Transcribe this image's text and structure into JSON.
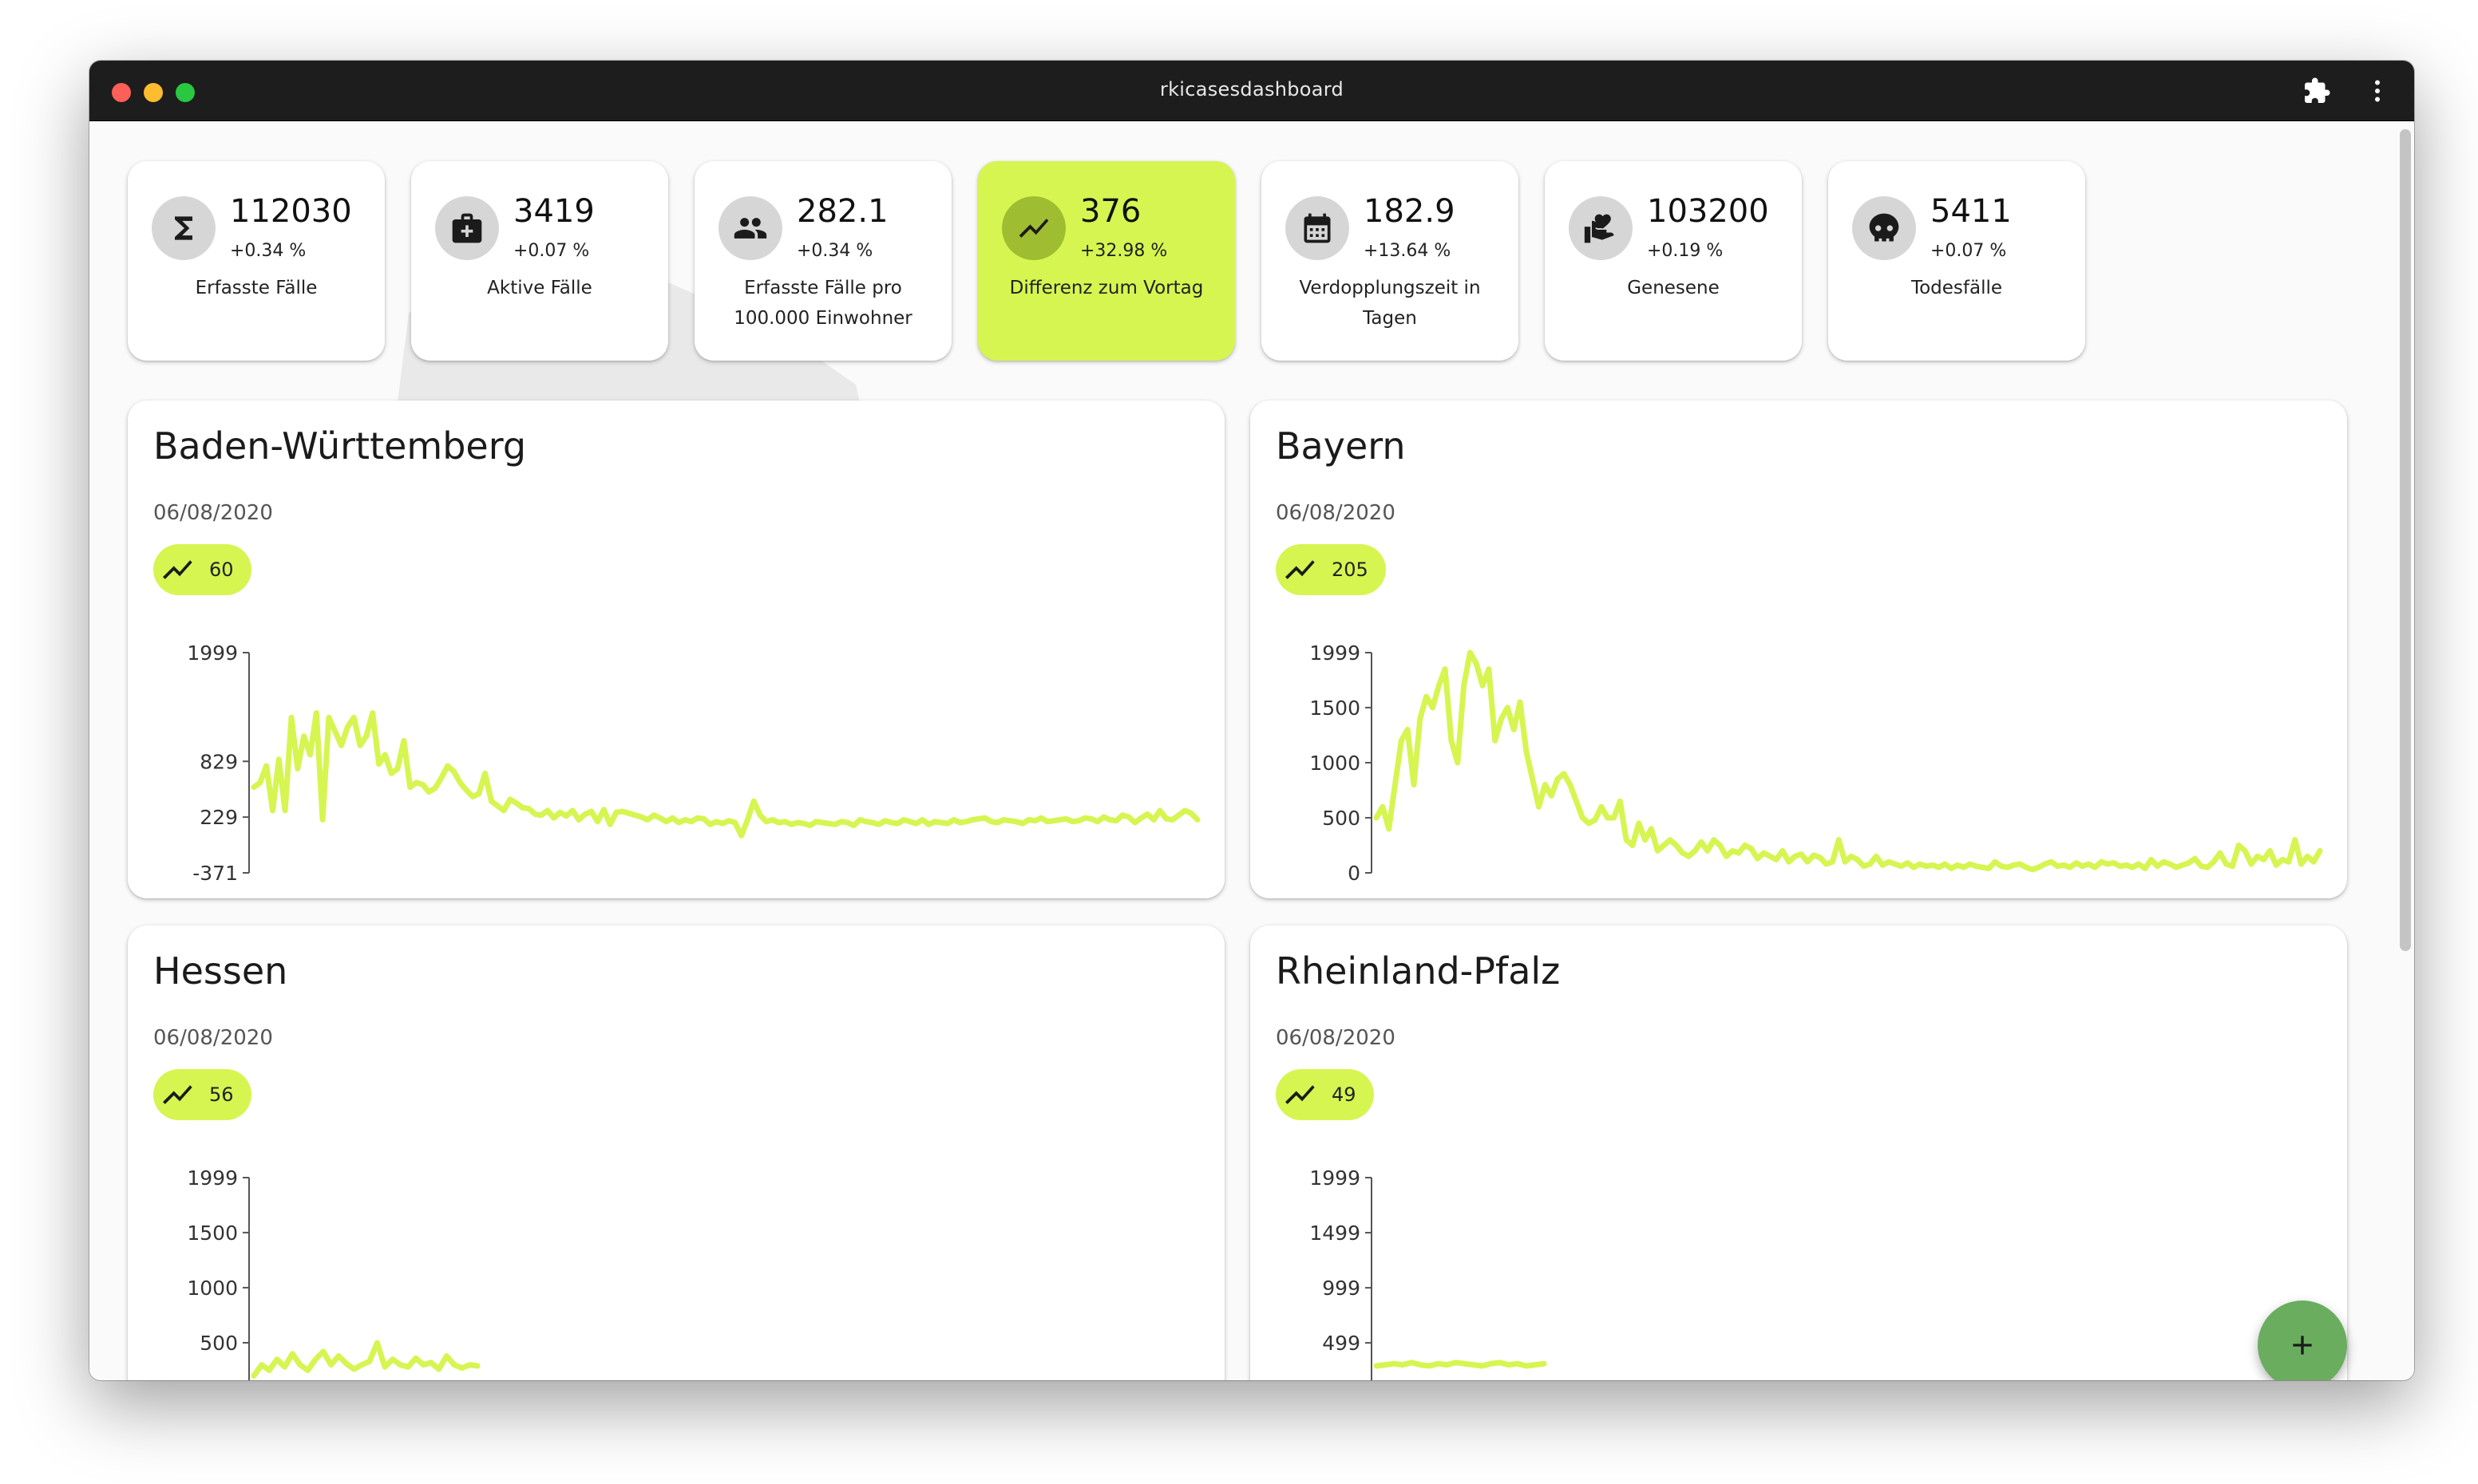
{
  "window": {
    "title": "rkicasesdashboard"
  },
  "colors": {
    "accent": "#d6f551",
    "line": "#d6f551",
    "fab": "#6aad5f",
    "titlebar": "#1d1d1d"
  },
  "stats": [
    {
      "icon": "sigma-icon",
      "value": "112030",
      "change": "+0.34 %",
      "label": "Erfasste Fälle",
      "active": false
    },
    {
      "icon": "medical-bag-icon",
      "value": "3419",
      "change": "+0.07 %",
      "label": "Aktive Fälle",
      "active": false
    },
    {
      "icon": "people-icon",
      "value": "282.1",
      "change": "+0.34 %",
      "label": "Erfasste Fälle pro 100.000 Einwohner",
      "active": false
    },
    {
      "icon": "trending-icon",
      "value": "376",
      "change": "+32.98 %",
      "label": "Differenz zum Vortag",
      "active": true
    },
    {
      "icon": "calendar-icon",
      "value": "182.9",
      "change": "+13.64 %",
      "label": "Verdopplungszeit in Tagen",
      "active": false
    },
    {
      "icon": "heart-hand-icon",
      "value": "103200",
      "change": "+0.19 %",
      "label": "Genesene",
      "active": false
    },
    {
      "icon": "skull-icon",
      "value": "5411",
      "change": "+0.07 %",
      "label": "Todesfälle",
      "active": false
    }
  ],
  "cards": [
    {
      "title": "Baden-Württemberg",
      "date": "06/08/2020",
      "chip_value": "60"
    },
    {
      "title": "Bayern",
      "date": "06/08/2020",
      "chip_value": "205"
    },
    {
      "title": "Hessen",
      "date": "06/08/2020",
      "chip_value": "56"
    },
    {
      "title": "Rheinland-Pfalz",
      "date": "06/08/2020",
      "chip_value": "49"
    }
  ],
  "chart_data": [
    {
      "type": "line",
      "title": "Baden-Württemberg",
      "yticks": [
        1999,
        829,
        229,
        -371
      ],
      "ylim": [
        -371,
        1999
      ],
      "series": [
        {
          "values": [
            550,
            600,
            780,
            300,
            850,
            300,
            1300,
            750,
            1100,
            900,
            1350,
            200,
            1300,
            1150,
            1000,
            1200,
            1300,
            1000,
            1100,
            1350,
            800,
            900,
            700,
            750,
            1050,
            550,
            600,
            580,
            500,
            540,
            650,
            780,
            720,
            600,
            520,
            450,
            480,
            700,
            400,
            350,
            300,
            420,
            380,
            330,
            320,
            260,
            250,
            300,
            220,
            280,
            240,
            300,
            200,
            260,
            290,
            180,
            310,
            150,
            280,
            290,
            270,
            250,
            230,
            200,
            250,
            220,
            180,
            220,
            170,
            200,
            180,
            220,
            210,
            150,
            180,
            160,
            190,
            170,
            30,
            200,
            400,
            250,
            180,
            200,
            170,
            180,
            150,
            170,
            160,
            140,
            180,
            170,
            160,
            150,
            180,
            170,
            140,
            200,
            180,
            170,
            150,
            190,
            170,
            160,
            200,
            180,
            160,
            200,
            150,
            180,
            170,
            160,
            200,
            170,
            180,
            200,
            210,
            220,
            180,
            170,
            200,
            190,
            180,
            160,
            200,
            190,
            220,
            180,
            190,
            200,
            210,
            180,
            190,
            220,
            210,
            180,
            230,
            200,
            190,
            250,
            230,
            170,
            220,
            260,
            200,
            300,
            210,
            200,
            250,
            300,
            270,
            200
          ]
        }
      ]
    },
    {
      "type": "line",
      "title": "Bayern",
      "yticks": [
        1999,
        1500,
        1000,
        500,
        0
      ],
      "ylim": [
        0,
        1999
      ],
      "series": [
        {
          "values": [
            500,
            600,
            400,
            800,
            1200,
            1300,
            800,
            1400,
            1600,
            1500,
            1700,
            1850,
            1200,
            1000,
            1700,
            2000,
            1900,
            1700,
            1850,
            1200,
            1400,
            1500,
            1300,
            1550,
            1100,
            850,
            600,
            800,
            700,
            850,
            900,
            800,
            650,
            500,
            450,
            480,
            600,
            500,
            500,
            650,
            300,
            250,
            450,
            300,
            400,
            200,
            250,
            300,
            250,
            180,
            150,
            200,
            280,
            200,
            300,
            250,
            150,
            200,
            180,
            250,
            220,
            130,
            180,
            150,
            120,
            200,
            100,
            150,
            170,
            100,
            160,
            140,
            80,
            100,
            300,
            100,
            150,
            120,
            60,
            80,
            150,
            70,
            100,
            80,
            60,
            90,
            50,
            80,
            60,
            70,
            50,
            80,
            40,
            70,
            50,
            80,
            60,
            50,
            40,
            100,
            60,
            50,
            70,
            80,
            50,
            30,
            50,
            80,
            100,
            60,
            70,
            50,
            90,
            60,
            80,
            50,
            100,
            80,
            90,
            60,
            70,
            50,
            80,
            40,
            120,
            60,
            100,
            80,
            50,
            70,
            90,
            130,
            60,
            50,
            100,
            180,
            80,
            60,
            250,
            200,
            80,
            150,
            120,
            200,
            70,
            120,
            100,
            300,
            80,
            150,
            100,
            200
          ]
        }
      ]
    },
    {
      "type": "line",
      "title": "Hessen",
      "yticks": [
        1999,
        1500,
        1000,
        500
      ],
      "ylim": [
        0,
        1999
      ],
      "series": [
        {
          "values": [
            200,
            300,
            250,
            350,
            280,
            400,
            300,
            250,
            350,
            420,
            300,
            380,
            310,
            260,
            300,
            330,
            500,
            280,
            350,
            300,
            280,
            360,
            300,
            320,
            260,
            380,
            300,
            270,
            300,
            290
          ]
        }
      ]
    },
    {
      "type": "line",
      "title": "Rheinland-Pfalz",
      "yticks": [
        1999,
        1499,
        999,
        499
      ],
      "ylim": [
        0,
        1999
      ],
      "series": [
        {
          "values": [
            290,
            300,
            310,
            300,
            320,
            300,
            290,
            310,
            300,
            320,
            310,
            300,
            290,
            310,
            320,
            300,
            310,
            290,
            300,
            310
          ]
        }
      ]
    }
  ]
}
